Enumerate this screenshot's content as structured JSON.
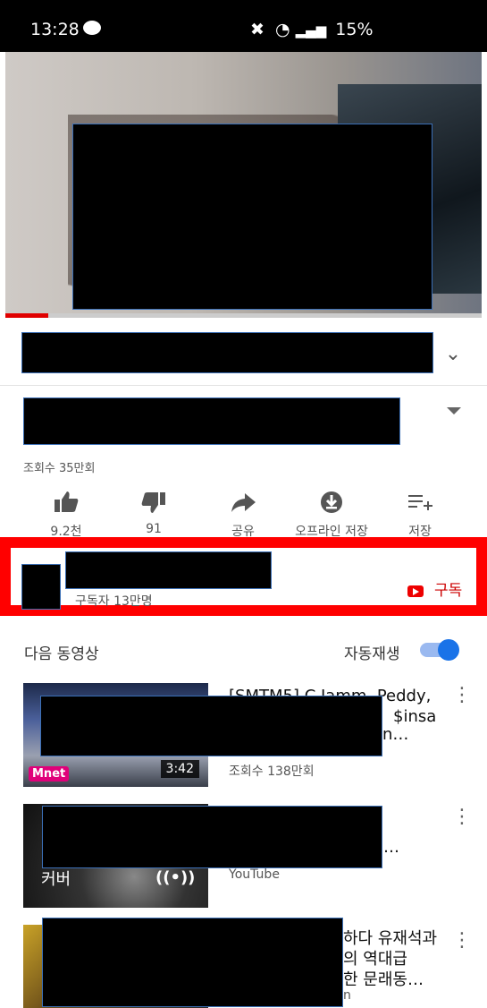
{
  "status_bar": {
    "time": "13:28",
    "battery": "15%",
    "icons": [
      "chat-icon",
      "mute-icon",
      "wifi-icon",
      "signal-icon"
    ]
  },
  "player": {
    "progress_fraction": 0.09,
    "progress_color": "#e00000"
  },
  "video_info": {
    "views": "조회수 35만회"
  },
  "actions": [
    {
      "icon": "thumbs-up-icon",
      "label": "9.2천"
    },
    {
      "icon": "thumbs-down-icon",
      "label": "91"
    },
    {
      "icon": "share-icon",
      "label": "공유"
    },
    {
      "icon": "download-icon",
      "label": "오프라인 저장"
    },
    {
      "icon": "save-playlist-icon",
      "label": "저장"
    }
  ],
  "channel": {
    "subscribers": "구독자 13만명",
    "subscribe_label": "구독"
  },
  "up_next": {
    "label": "다음 동영상",
    "autoplay_label": "자동재생",
    "autoplay_on": true
  },
  "videos": [
    {
      "title_visible": "[SMTM5] C Jamm, Peddy,",
      "title_visible_2": "$insa",
      "title_visible_3": "n…",
      "meta": "조회수 138만회",
      "duration": "3:42",
      "thumb_badge": "Mnet"
    },
    {
      "title_visible": "…",
      "meta": "YouTube",
      "thumb_caption": "커버"
    },
    {
      "title_visible": "하다 유재석과",
      "title_visible_2": "의 역대급",
      "title_visible_3": "한 문래동…",
      "meta": "n"
    }
  ]
}
